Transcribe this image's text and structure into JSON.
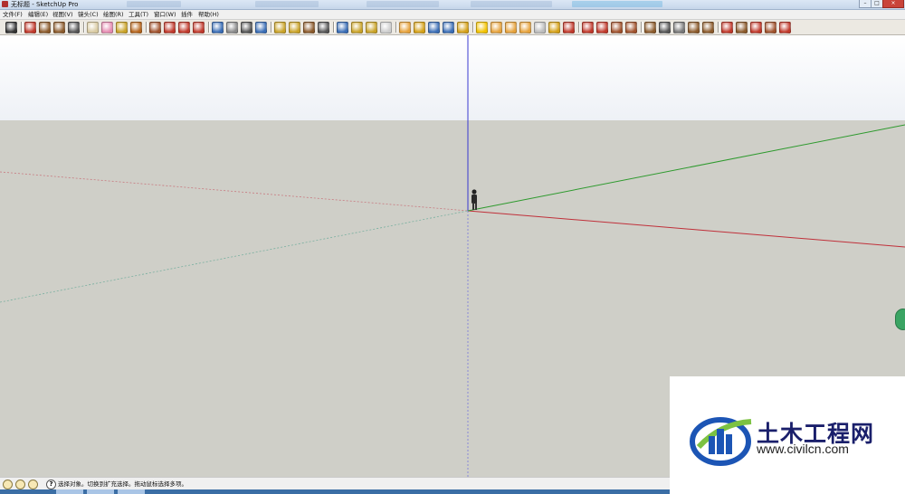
{
  "window": {
    "title": "无标题 - SketchUp Pro"
  },
  "menu": [
    {
      "id": "file",
      "label": "文件(F)"
    },
    {
      "id": "edit",
      "label": "编辑(E)"
    },
    {
      "id": "view",
      "label": "视图(V)"
    },
    {
      "id": "camera",
      "label": "镜头(C)"
    },
    {
      "id": "draw",
      "label": "绘图(R)"
    },
    {
      "id": "tools",
      "label": "工具(T)"
    },
    {
      "id": "window",
      "label": "窗口(W)"
    },
    {
      "id": "plugins",
      "label": "插件"
    },
    {
      "id": "help",
      "label": "帮助(H)"
    }
  ],
  "toolbar": [
    {
      "name": "select-icon",
      "color": "#333333"
    },
    {
      "name": "pencil-icon",
      "color": "#c0392b"
    },
    {
      "name": "rectangle-icon",
      "color": "#8b5a2b"
    },
    {
      "name": "circle-icon",
      "color": "#8b5a2b"
    },
    {
      "name": "arc-icon",
      "color": "#555555"
    },
    {
      "name": "make-component-icon",
      "color": "#d8c9a0"
    },
    {
      "name": "eraser-icon",
      "color": "#e58ab0"
    },
    {
      "name": "tape-measure-icon",
      "color": "#c9a227"
    },
    {
      "name": "paint-bucket-icon",
      "color": "#b5651d"
    },
    {
      "name": "push-pull-icon",
      "color": "#a0522d"
    },
    {
      "name": "move-icon",
      "color": "#c0392b"
    },
    {
      "name": "rotate-icon",
      "color": "#c0392b"
    },
    {
      "name": "follow-me-icon",
      "color": "#c0392b"
    },
    {
      "name": "orbit-icon",
      "color": "#3a6db5"
    },
    {
      "name": "pan-icon",
      "color": "#888888"
    },
    {
      "name": "zoom-icon",
      "color": "#555555"
    },
    {
      "name": "zoom-extents-icon",
      "color": "#3a6db5"
    },
    {
      "name": "iso-view-icon",
      "color": "#c9a227"
    },
    {
      "name": "top-view-icon",
      "color": "#c9a227"
    },
    {
      "name": "walk-icon",
      "color": "#8b5a2b"
    },
    {
      "name": "look-around-icon",
      "color": "#555555"
    },
    {
      "name": "position-camera-icon",
      "color": "#3a6db5"
    },
    {
      "name": "x-ray-icon",
      "color": "#c9a227"
    },
    {
      "name": "back-edges-icon",
      "color": "#c9a227"
    },
    {
      "name": "wireframe-icon",
      "color": "#cccccc"
    },
    {
      "name": "model-info-icon",
      "color": "#e6a23c"
    },
    {
      "name": "warehouse-icon",
      "color": "#d4a017"
    },
    {
      "name": "share-model-icon",
      "color": "#3a6db5"
    },
    {
      "name": "share-component-icon",
      "color": "#3a6db5"
    },
    {
      "name": "extension-icon",
      "color": "#d4a017"
    },
    {
      "name": "sun-icon",
      "color": "#f2c200"
    },
    {
      "name": "section-plane-icon",
      "color": "#e6a23c"
    },
    {
      "name": "flag-icon",
      "color": "#e6a23c"
    },
    {
      "name": "axes-icon",
      "color": "#e6a23c"
    },
    {
      "name": "sphere-icon",
      "color": "#bbbbbb"
    },
    {
      "name": "sandbox-icon",
      "color": "#d4a017"
    },
    {
      "name": "color-wheel-icon",
      "color": "#c0392b"
    },
    {
      "name": "dimension-icon",
      "color": "#c0392b"
    },
    {
      "name": "protractor-icon",
      "color": "#c0392b"
    },
    {
      "name": "text-icon",
      "color": "#a0522d"
    },
    {
      "name": "axis-tool-icon",
      "color": "#a0522d"
    },
    {
      "name": "offset-icon",
      "color": "#8b5a2b"
    },
    {
      "name": "intersect-icon",
      "color": "#555555"
    },
    {
      "name": "solid-tools-icon",
      "color": "#777777"
    },
    {
      "name": "stamp-icon",
      "color": "#8b5a2b"
    },
    {
      "name": "drape-icon",
      "color": "#8b5a2b"
    },
    {
      "name": "smoove-icon",
      "color": "#c0392b"
    },
    {
      "name": "flip-edge-icon",
      "color": "#8b5a2b"
    },
    {
      "name": "add-detail-icon",
      "color": "#c0392b"
    },
    {
      "name": "from-contours-icon",
      "color": "#a0522d"
    },
    {
      "name": "help-icon",
      "color": "#c0392b"
    }
  ],
  "statusbar": {
    "text": "选择对象。切换到扩充选择。拖动鼠标选择多项。"
  },
  "watermark": {
    "title": "土木工程网",
    "url": "www.civilcn.com"
  }
}
